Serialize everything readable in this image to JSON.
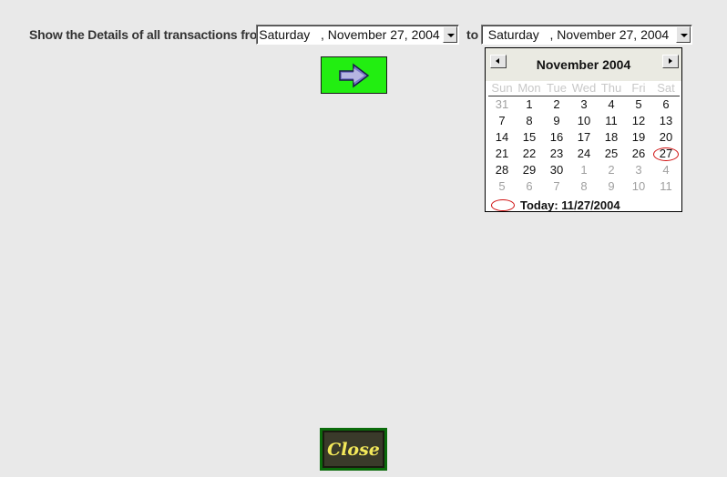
{
  "header": {
    "prompt_label": "Show the Details of all transactions from",
    "to_label": "to"
  },
  "date_from": {
    "value": "Saturday   , November 27, 2004"
  },
  "date_to": {
    "value": "Saturday   , November 27, 2004"
  },
  "calendar": {
    "title": "November 2004",
    "days_of_week": [
      "Sun",
      "Mon",
      "Tue",
      "Wed",
      "Thu",
      "Fri",
      "Sat"
    ],
    "weeks": [
      [
        "31",
        "1",
        "2",
        "3",
        "4",
        "5",
        "6"
      ],
      [
        "7",
        "8",
        "9",
        "10",
        "11",
        "12",
        "13"
      ],
      [
        "14",
        "15",
        "16",
        "17",
        "18",
        "19",
        "20"
      ],
      [
        "21",
        "22",
        "23",
        "24",
        "25",
        "26",
        "27"
      ],
      [
        "28",
        "29",
        "30",
        "1",
        "2",
        "3",
        "4"
      ],
      [
        "5",
        "6",
        "7",
        "8",
        "9",
        "10",
        "11"
      ]
    ],
    "selected_day": "27",
    "today_label": "Today: 11/27/2004"
  },
  "buttons": {
    "go_icon": "right-arrow-icon",
    "close_label": "Close"
  },
  "colors": {
    "go_button_bg": "#22ee11",
    "close_text": "#f3e85a",
    "close_border": "#0b6b0b",
    "selected_circle": "#d01010"
  }
}
